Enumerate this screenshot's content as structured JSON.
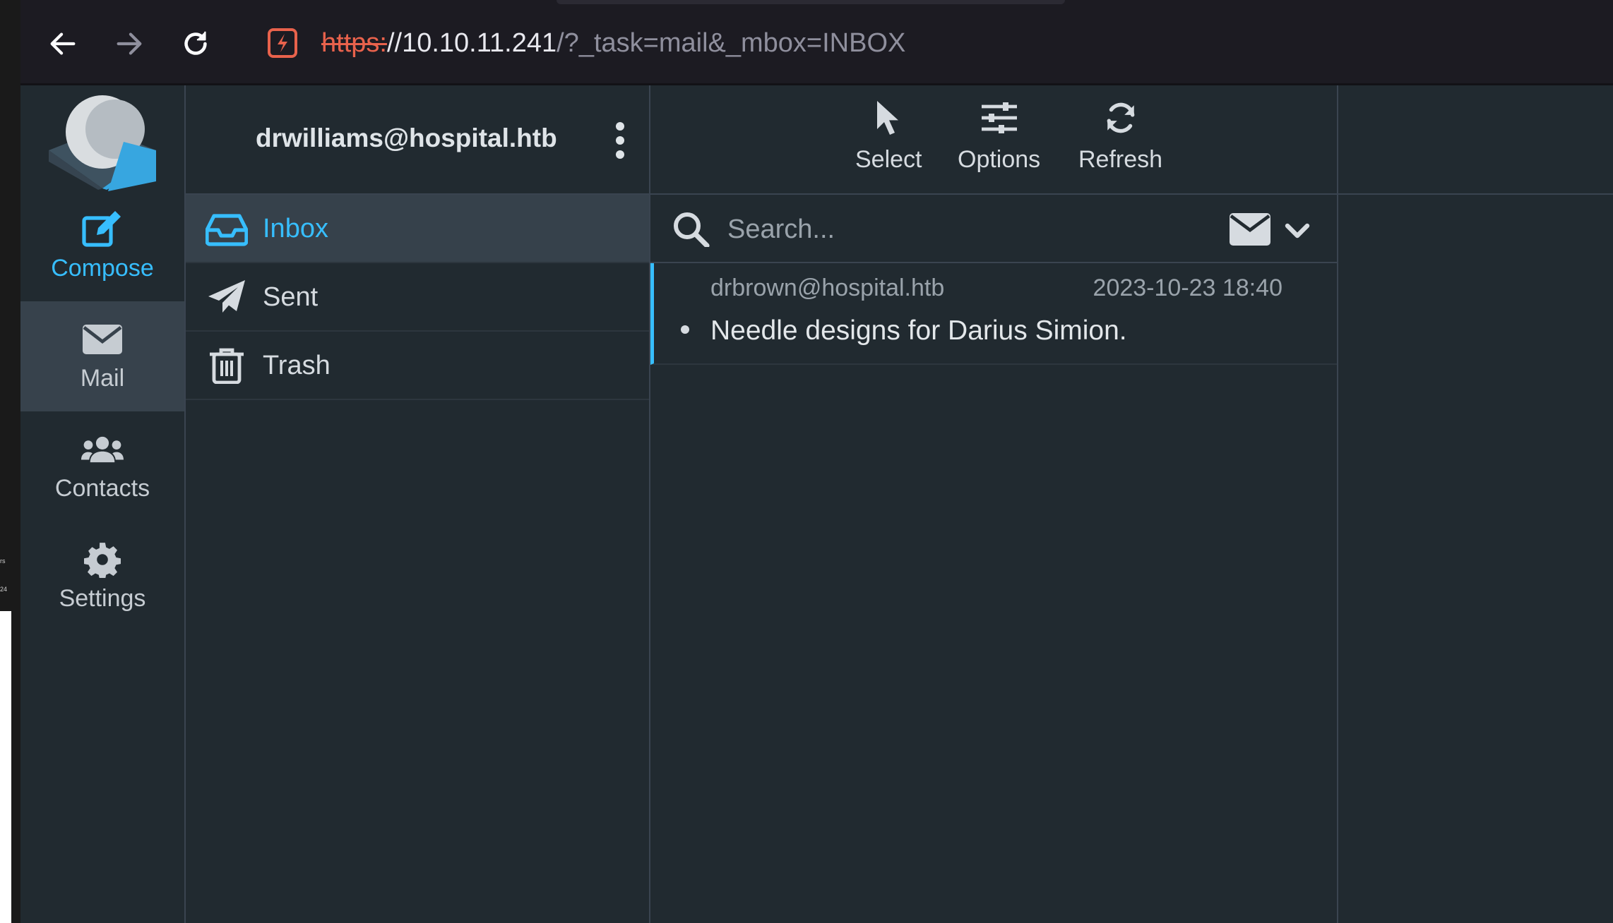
{
  "browser": {
    "url_scheme": "https:",
    "url_host": "//10.10.11.241",
    "url_path": "/?_task=mail&_mbox=INBOX"
  },
  "desktop": {
    "snippet_top": "rs",
    "snippet_bottom": "24"
  },
  "rail": {
    "compose": "Compose",
    "mail": "Mail",
    "contacts": "Contacts",
    "settings": "Settings"
  },
  "account": "drwilliams@hospital.htb",
  "folders": [
    {
      "label": "Inbox",
      "icon": "inbox-icon"
    },
    {
      "label": "Sent",
      "icon": "paper-plane-icon"
    },
    {
      "label": "Trash",
      "icon": "trash-icon"
    }
  ],
  "toolbar": {
    "select": "Select",
    "options": "Options",
    "refresh": "Refresh"
  },
  "search": {
    "placeholder": "Search..."
  },
  "messages": [
    {
      "from": "drbrown@hospital.htb",
      "date": "2023-10-23 18:40",
      "subject": "Needle designs for Darius Simion."
    }
  ],
  "colors": {
    "accent": "#37beff",
    "background": "#212a30",
    "insecure": "#e8624c"
  }
}
